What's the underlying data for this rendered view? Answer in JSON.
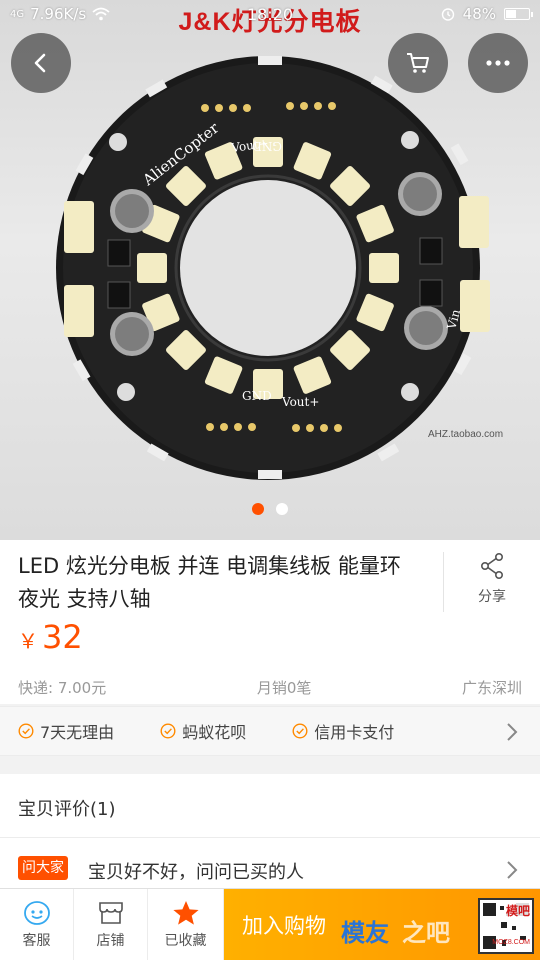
{
  "status_bar": {
    "signal": "4G",
    "network_speed": "7.96K/s",
    "time": "18:20",
    "battery_percent": "48%",
    "battery_level": 0.48
  },
  "hero": {
    "image_title": "J&K灯光分电板",
    "board_brand": "AlienCopter",
    "labels": {
      "gnd": "GND",
      "vout": "Vout+",
      "vin": "Vin"
    },
    "shop_watermark": "AHZ.taobao.com",
    "carousel_count": 2,
    "carousel_active": 1
  },
  "nav": {
    "back_icon": "chevron-left-icon",
    "cart_icon": "cart-icon",
    "more_icon": "more-horizontal-icon"
  },
  "product": {
    "title": "LED 炫光分电板 并连 电调集线板 能量环 夜光 支持八轴",
    "share_label": "分享",
    "currency": "￥",
    "price": "32",
    "shipping": "快递: 7.00元",
    "monthly_sales": "月销0笔",
    "location": "广东深圳"
  },
  "services": [
    "7天无理由",
    "蚂蚁花呗",
    "信用卡支付"
  ],
  "reviews": {
    "title": "宝贝评价(1)",
    "ask_badge": "问大家",
    "ask_text": "宝贝好不好，问问已买的人"
  },
  "bottom_bar": {
    "service": "客服",
    "store": "店铺",
    "favorited": "已收藏",
    "add_to_cart": "加入购物",
    "watermark_1": "模友",
    "watermark_2": "之吧",
    "watermark_3": "模吧",
    "watermark_4": "MOZ8.COM"
  },
  "colors": {
    "accent": "#ff5000",
    "add_cart": "#ffa000",
    "favorite_star": "#ff5000"
  }
}
